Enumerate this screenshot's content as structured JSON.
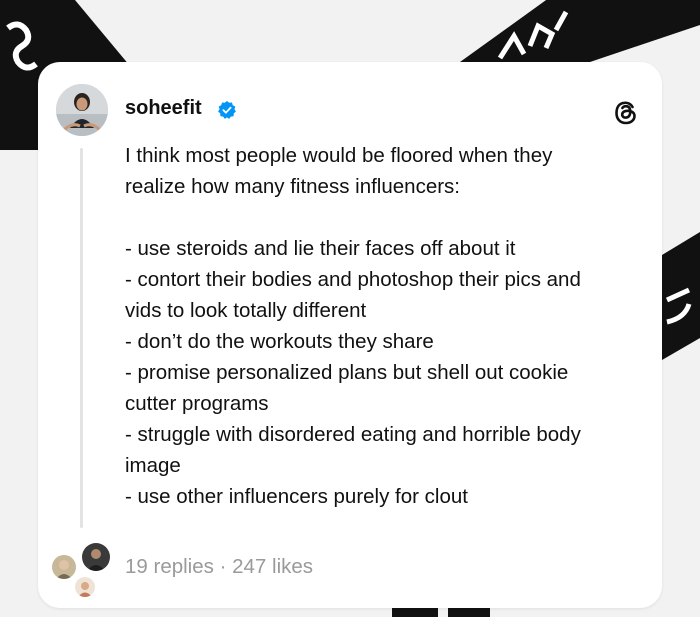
{
  "post": {
    "username": "soheefit",
    "verified": true,
    "text": "I think most people would be floored when they\nrealize how many fitness influencers:\n\n- use steroids and lie their faces off about it\n- contort their bodies and photoshop their pics and\nvids to look totally different\n- don’t do the workouts they share\n- promise personalized plans but shell out cookie\ncutter programs\n- struggle with disordered eating and horrible body\nimage\n- use other influencers purely for clout",
    "replies": "19 replies",
    "separator": "·",
    "likes": "247 likes"
  },
  "icons": {
    "verified": "verified-badge-icon",
    "logo": "threads-logo-icon"
  },
  "colors": {
    "verified_blue": "#0095f6",
    "stats_gray": "#9a9a9a",
    "background_stripe": "#111111"
  }
}
